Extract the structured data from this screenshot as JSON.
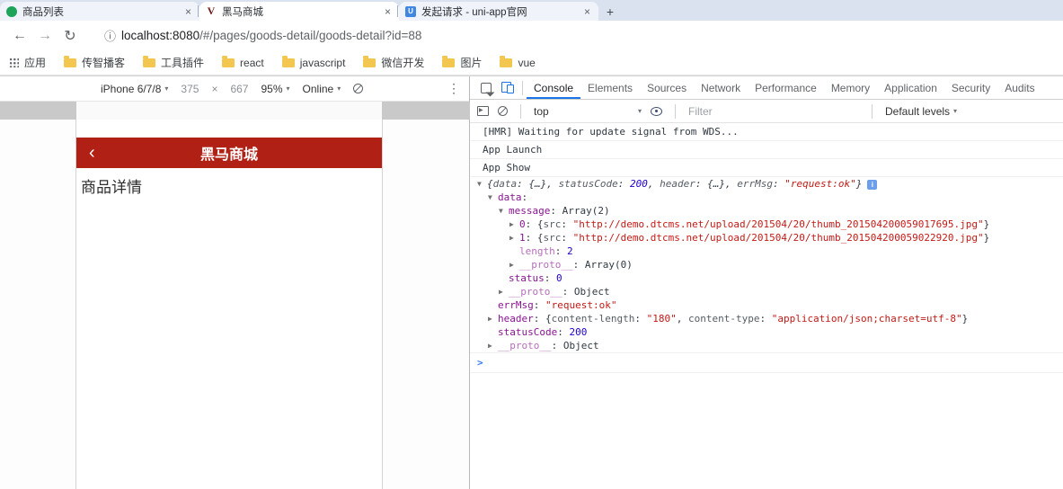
{
  "colors": {
    "accent": "#1a73e8",
    "app_header": "#b02015",
    "key_purple": "#881391",
    "number_blue": "#1c00cf",
    "string_red": "#c41a16"
  },
  "icons": {
    "close": "×",
    "plus": "+",
    "caret": "▾",
    "back": "←",
    "forward": "→",
    "reload": "↻",
    "page_info": "ⓘ",
    "more": "⋮",
    "times": "×",
    "info_badge": "i",
    "prompt": ">",
    "back_chevron": "‹"
  },
  "browser": {
    "tabs": [
      {
        "title": "商品列表"
      },
      {
        "title": "黑马商城"
      },
      {
        "title": "发起请求 - uni-app官网"
      }
    ],
    "url": {
      "host": "localhost:8080",
      "path": "/#/pages/goods-detail/goods-detail?id=88"
    },
    "bookmarks": [
      {
        "label": "应用"
      },
      {
        "label": "传智播客"
      },
      {
        "label": "工具插件"
      },
      {
        "label": "react"
      },
      {
        "label": "javascript"
      },
      {
        "label": "微信开发"
      },
      {
        "label": "图片"
      },
      {
        "label": "vue"
      }
    ]
  },
  "device_toolbar": {
    "device": "iPhone 6/7/8",
    "width": "375",
    "height": "667",
    "zoom": "95%",
    "network": "Online"
  },
  "app": {
    "title": "黑马商城",
    "page_text": "商品详情"
  },
  "devtools": {
    "tabs": [
      "Console",
      "Elements",
      "Sources",
      "Network",
      "Performance",
      "Memory",
      "Application",
      "Security",
      "Audits"
    ],
    "active_tab": "Console",
    "toolbar": {
      "context": "top",
      "filter_placeholder": "Filter",
      "levels": "Default levels"
    },
    "console": {
      "lines": [
        {
          "type": "log",
          "border": true,
          "text": "[HMR] Waiting for update signal from WDS..."
        },
        {
          "type": "log",
          "border": true,
          "text": "App Launch"
        },
        {
          "type": "log",
          "border": true,
          "text": "App Show"
        },
        {
          "type": "tree",
          "indent": 0,
          "exp": "▼",
          "italic": true,
          "icon": true,
          "segs": [
            [
              "p",
              "{"
            ],
            [
              "kp",
              "data"
            ],
            [
              "p",
              ": "
            ],
            [
              "v",
              "{…}"
            ],
            [
              "p",
              ", "
            ],
            [
              "kp",
              "statusCode"
            ],
            [
              "p",
              ": "
            ],
            [
              "n",
              "200"
            ],
            [
              "p",
              ", "
            ],
            [
              "kp",
              "header"
            ],
            [
              "p",
              ": "
            ],
            [
              "v",
              "{…}"
            ],
            [
              "p",
              ", "
            ],
            [
              "kp",
              "errMsg"
            ],
            [
              "p",
              ": "
            ],
            [
              "s",
              "\"request:ok\""
            ],
            [
              "p",
              "}"
            ]
          ]
        },
        {
          "type": "tree",
          "indent": 1,
          "exp": "▼",
          "segs": [
            [
              "k",
              "data"
            ],
            [
              "p",
              ":"
            ]
          ]
        },
        {
          "type": "tree",
          "indent": 2,
          "exp": "▼",
          "segs": [
            [
              "k",
              "message"
            ],
            [
              "p",
              ": "
            ],
            [
              "v",
              "Array(2)"
            ]
          ]
        },
        {
          "type": "tree",
          "indent": 3,
          "exp": "▶",
          "segs": [
            [
              "k",
              "0"
            ],
            [
              "p",
              ": {"
            ],
            [
              "kp",
              "src"
            ],
            [
              "p",
              ": "
            ],
            [
              "s",
              "\"http://demo.dtcms.net/upload/201504/20/thumb_201504200059017695.jpg\""
            ],
            [
              "p",
              "}"
            ]
          ]
        },
        {
          "type": "tree",
          "indent": 3,
          "exp": "▶",
          "segs": [
            [
              "k",
              "1"
            ],
            [
              "p",
              ": {"
            ],
            [
              "kp",
              "src"
            ],
            [
              "p",
              ": "
            ],
            [
              "s",
              "\"http://demo.dtcms.net/upload/201504/20/thumb_201504200059022920.jpg\""
            ],
            [
              "p",
              "}"
            ]
          ]
        },
        {
          "type": "tree",
          "indent": 3,
          "segs": [
            [
              "kd",
              "length"
            ],
            [
              "p",
              ": "
            ],
            [
              "n",
              "2"
            ]
          ]
        },
        {
          "type": "tree",
          "indent": 3,
          "exp": "▶",
          "segs": [
            [
              "kd",
              "__proto__"
            ],
            [
              "p",
              ": "
            ],
            [
              "v",
              "Array(0)"
            ]
          ]
        },
        {
          "type": "tree",
          "indent": 2,
          "segs": [
            [
              "k",
              "status"
            ],
            [
              "p",
              ": "
            ],
            [
              "n",
              "0"
            ]
          ]
        },
        {
          "type": "tree",
          "indent": 2,
          "exp": "▶",
          "segs": [
            [
              "kd",
              "__proto__"
            ],
            [
              "p",
              ": "
            ],
            [
              "v",
              "Object"
            ]
          ]
        },
        {
          "type": "tree",
          "indent": 1,
          "segs": [
            [
              "k",
              "errMsg"
            ],
            [
              "p",
              ": "
            ],
            [
              "s",
              "\"request:ok\""
            ]
          ]
        },
        {
          "type": "tree",
          "indent": 1,
          "exp": "▶",
          "segs": [
            [
              "k",
              "header"
            ],
            [
              "p",
              ": {"
            ],
            [
              "kp",
              "content-length"
            ],
            [
              "p",
              ": "
            ],
            [
              "s",
              "\"180\""
            ],
            [
              "p",
              ", "
            ],
            [
              "kp",
              "content-type"
            ],
            [
              "p",
              ": "
            ],
            [
              "s",
              "\"application/json;charset=utf-8\""
            ],
            [
              "p",
              "}"
            ]
          ]
        },
        {
          "type": "tree",
          "indent": 1,
          "segs": [
            [
              "k",
              "statusCode"
            ],
            [
              "p",
              ": "
            ],
            [
              "n",
              "200"
            ]
          ]
        },
        {
          "type": "tree",
          "indent": 1,
          "exp": "▶",
          "border": true,
          "segs": [
            [
              "kd",
              "__proto__"
            ],
            [
              "p",
              ": "
            ],
            [
              "v",
              "Object"
            ]
          ]
        },
        {
          "type": "prompt",
          "border": true
        }
      ]
    }
  }
}
